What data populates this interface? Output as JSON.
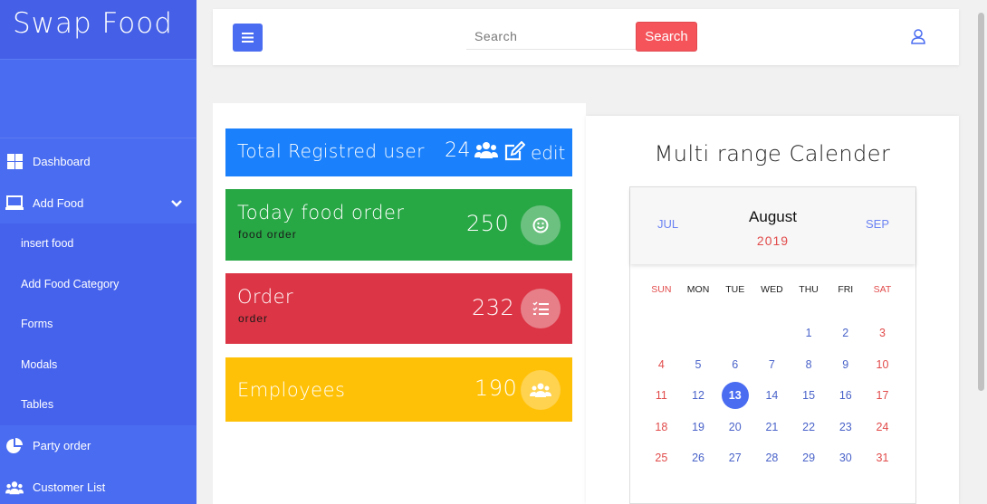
{
  "brand": "Swap Food",
  "sidebar": {
    "items": [
      {
        "label": "Dashboard",
        "icon": "grid-icon"
      },
      {
        "label": "Add Food",
        "icon": "laptop-icon"
      }
    ],
    "submenu": [
      "insert food",
      "Add Food Category",
      "Forms",
      "Modals",
      "Tables"
    ],
    "bottom": [
      {
        "label": "Party order",
        "icon": "pie-chart-icon"
      },
      {
        "label": "Customer List",
        "icon": "users-icon"
      }
    ]
  },
  "topbar": {
    "search_placeholder": "Search",
    "search_button": "Search"
  },
  "stats": [
    {
      "title": "Total Registred user",
      "value": "24",
      "extra": "edit",
      "color": "#1a80fb"
    },
    {
      "title": "Today food order",
      "sub": "food order",
      "value": "250",
      "color": "#28a745"
    },
    {
      "title": "Order",
      "sub": "order",
      "value": "232",
      "color": "#dc3545"
    },
    {
      "title": "Employees",
      "value": "190",
      "color": "#ffc107"
    }
  ],
  "calendar": {
    "heading": "Multi range Calender",
    "prev": "JUL",
    "month": "August",
    "year": "2019",
    "next": "SEP",
    "weekdays": [
      "SUN",
      "MON",
      "TUE",
      "WED",
      "THU",
      "FRI",
      "SAT"
    ],
    "selected_day": "13",
    "days": [
      "",
      "",
      "",
      "",
      "1",
      "2",
      "3",
      "4",
      "5",
      "6",
      "7",
      "8",
      "9",
      "10",
      "11",
      "12",
      "13",
      "14",
      "15",
      "16",
      "17",
      "18",
      "19",
      "20",
      "21",
      "22",
      "23",
      "24",
      "25",
      "26",
      "27",
      "28",
      "29",
      "30",
      "31"
    ]
  }
}
